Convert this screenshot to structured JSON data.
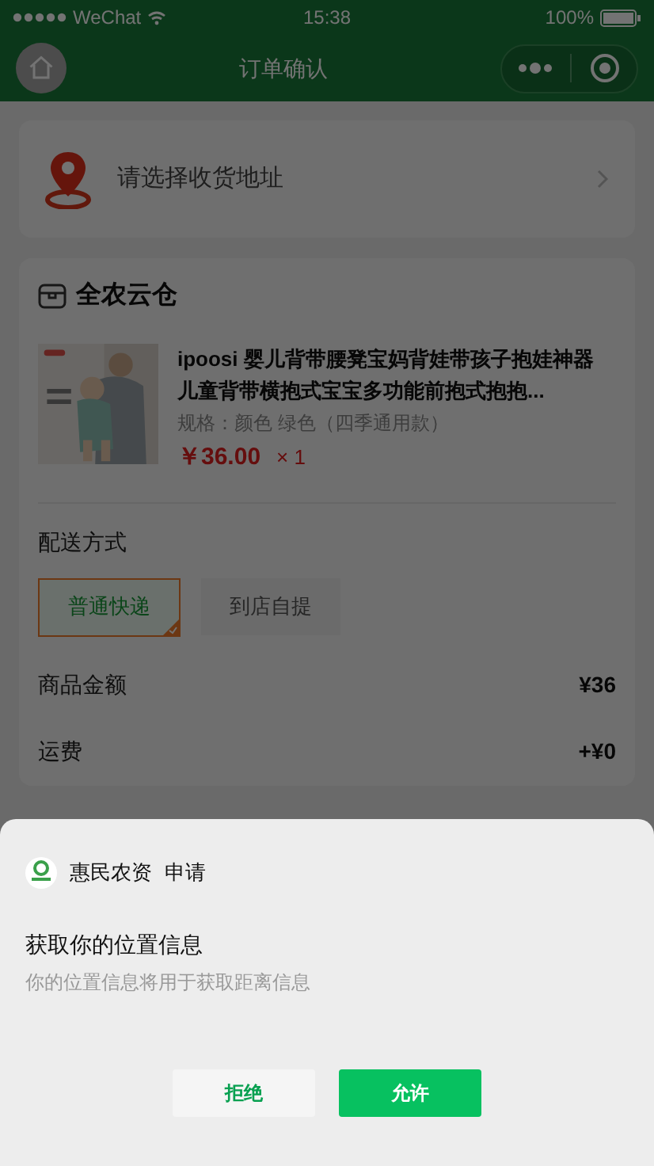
{
  "status_bar": {
    "carrier": "WeChat",
    "time": "15:38",
    "battery": "100%"
  },
  "nav_bar": {
    "title": "订单确认"
  },
  "address": {
    "placeholder": "请选择收货地址"
  },
  "store": {
    "name": "全农云仓",
    "product": {
      "title": "ipoosi 婴儿背带腰凳宝妈背娃带孩子抱娃神器儿童背带横抱式宝宝多功能前抱式抱抱...",
      "spec": "规格：颜色 绿色（四季通用款）",
      "price": "￥36.00",
      "quantity": "× 1"
    },
    "delivery": {
      "label": "配送方式",
      "options": [
        {
          "label": "普通快递",
          "selected": true
        },
        {
          "label": "到店自提",
          "selected": false
        }
      ]
    },
    "summary": [
      {
        "label": "商品金额",
        "value": "¥36"
      },
      {
        "label": "运费",
        "value": "+¥0"
      }
    ]
  },
  "permission_sheet": {
    "app_name": "惠民农资",
    "request": "申请",
    "title": "获取你的位置信息",
    "description": "你的位置信息将用于获取距离信息",
    "buttons": [
      {
        "label": "拒绝",
        "kind": "secondary"
      },
      {
        "label": "允许",
        "kind": "primary"
      }
    ]
  }
}
